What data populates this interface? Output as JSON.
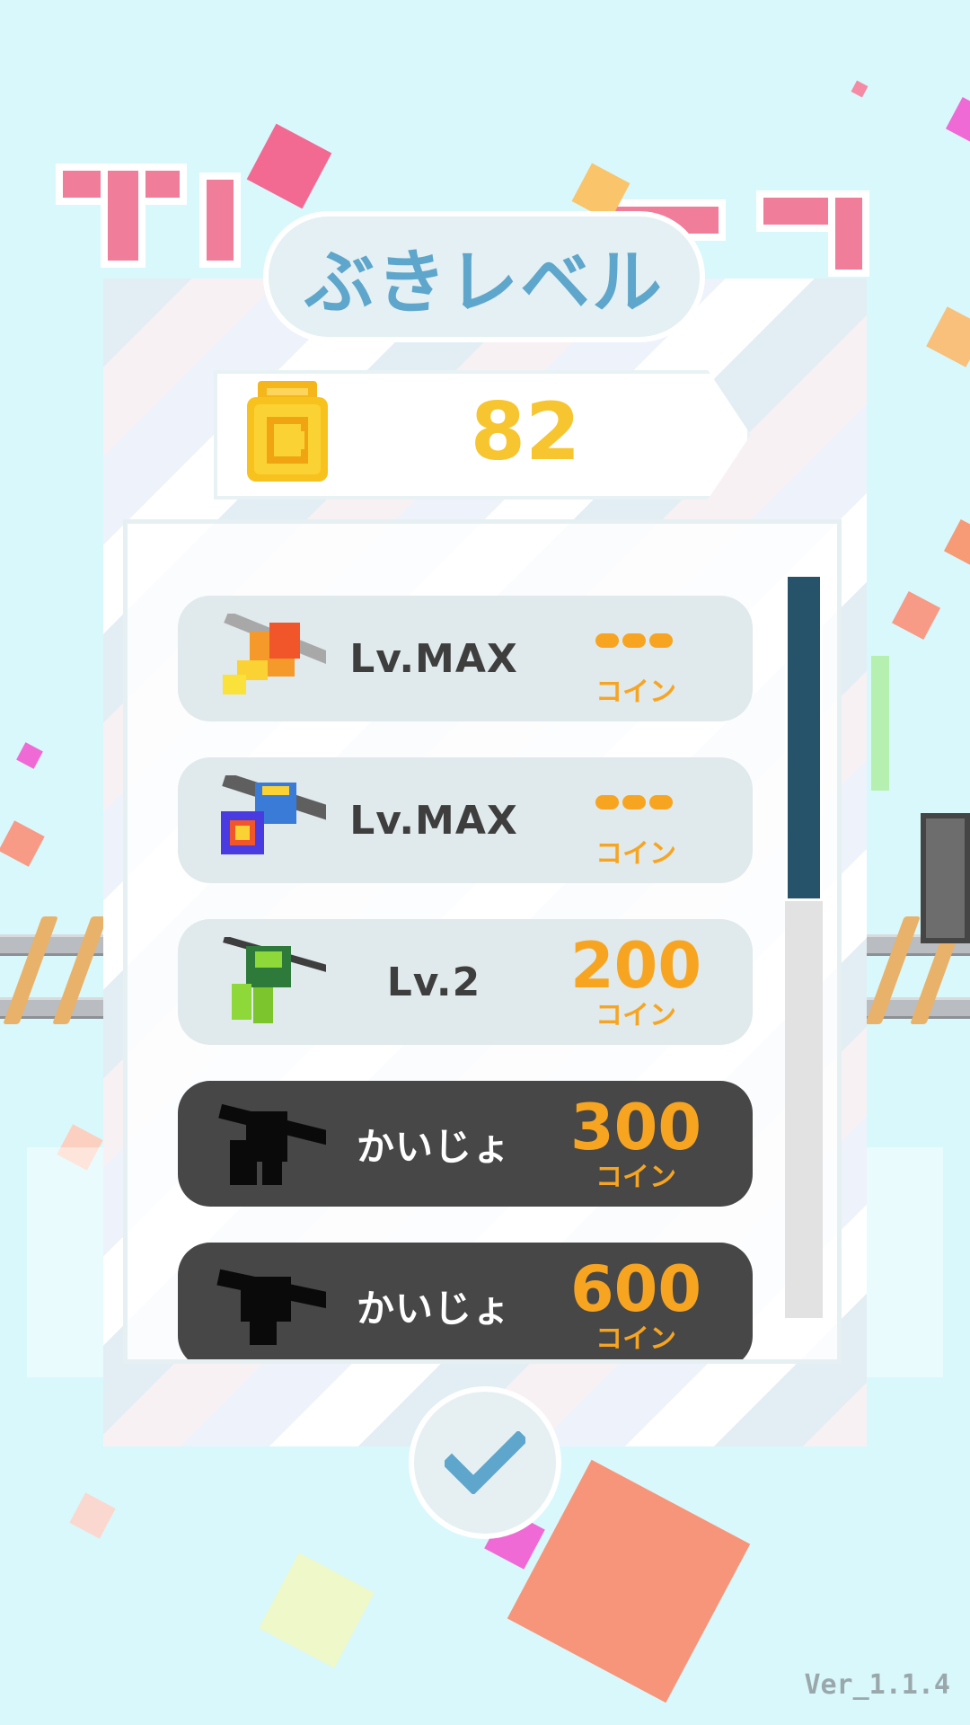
{
  "dialog": {
    "title": "ぶきレベル",
    "coins": "82",
    "confirm_icon": "checkmark-icon"
  },
  "weapons": [
    {
      "level": "Lv.MAX",
      "price": "",
      "unit": "コイン",
      "state": "max",
      "icon": "orange-drill-weapon-icon"
    },
    {
      "level": "Lv.MAX",
      "price": "",
      "unit": "コイン",
      "state": "max",
      "icon": "blue-cannon-weapon-icon"
    },
    {
      "level": "Lv.2",
      "price": "200",
      "unit": "コイン",
      "state": "upgrade",
      "icon": "green-twin-weapon-icon"
    },
    {
      "level": "かいじょ",
      "price": "300",
      "unit": "コイン",
      "state": "locked",
      "icon": "locked-weapon-silhouette-icon"
    },
    {
      "level": "かいじょ",
      "price": "600",
      "unit": "コイン",
      "state": "locked",
      "icon": "locked-weapon-silhouette-icon"
    }
  ],
  "scroll": {
    "position": 0.0,
    "visible_fraction": 0.44
  },
  "footer": {
    "version": "Ver_1.1.4"
  },
  "colors": {
    "background": "#d9f8fc",
    "accent_title": "#5ea6cb",
    "coin": "#f7c52f",
    "price": "#f7a521",
    "scroll_thumb": "#26536a",
    "locked_row": "#474747"
  }
}
